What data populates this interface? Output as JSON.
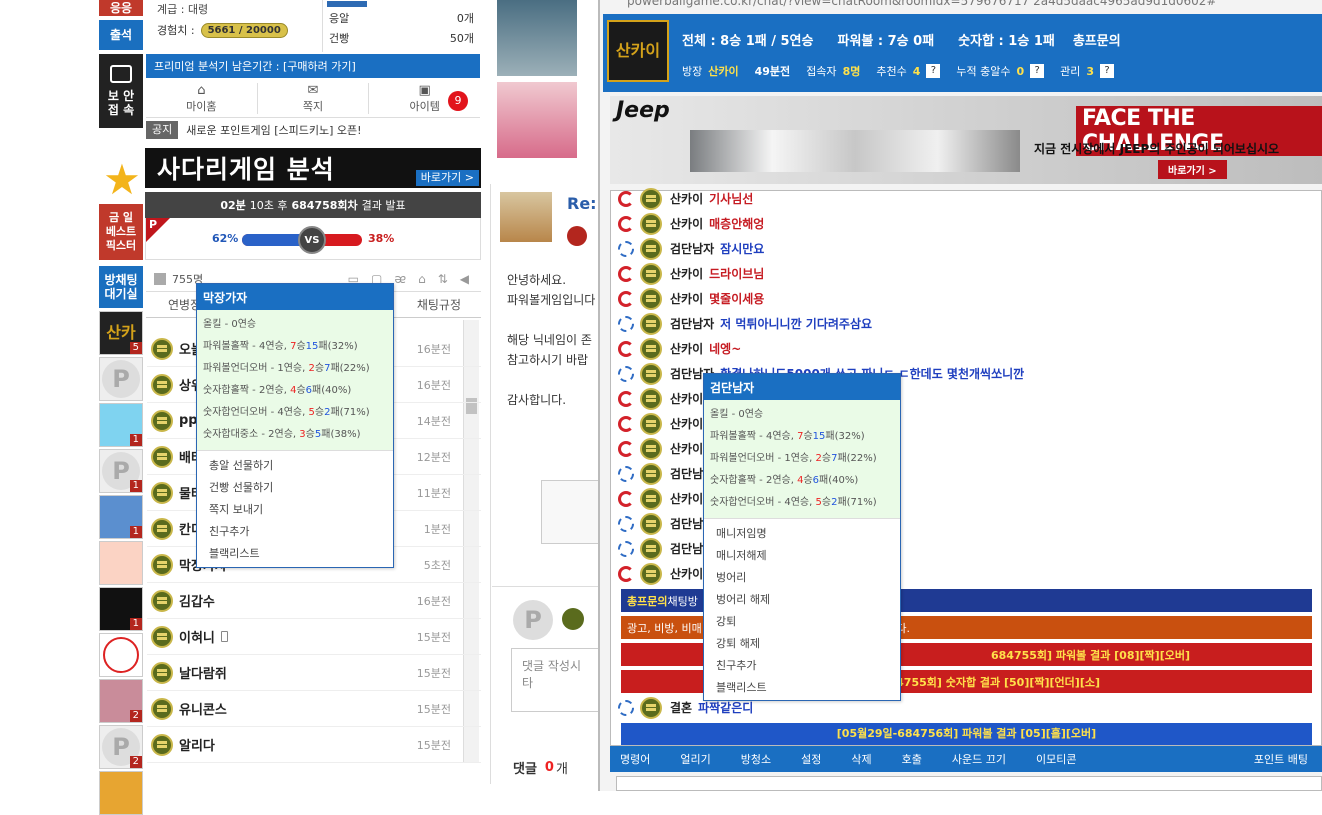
{
  "left_menu": {
    "top_btn": "응응",
    "attendance": "출석",
    "security": "보 안\n접 속",
    "best": "금 일\n베스트\n픽스터",
    "waiting_room": "방채팅\n대기실"
  },
  "profile": {
    "grade_label": "계급 : 대령",
    "exp_label": "경험치 :",
    "exp_value": "5661 / 20000",
    "premium": "프리미엄 분석기 남은기간 : [구매하려 가기]",
    "nav": [
      "마이홈",
      "쪽지",
      "아이템"
    ],
    "item_count": "9",
    "notice_tag": "공지",
    "notice": "새로운 포인트게임 [스피드키노] 오픈!",
    "stats": [
      {
        "label": "응알",
        "value": "0개"
      },
      {
        "label": "건빵",
        "value": "50개"
      }
    ]
  },
  "ladder": {
    "banner": "사다리게임 분석",
    "banner_btn": "바로가기 >",
    "countdown_pre": "02분",
    "countdown_mid": "10초 후",
    "round": "684758회차",
    "countdown_post": "결과 발표",
    "left_pct": "62%",
    "right_pct": "38%",
    "vs": "VS",
    "left_pct_value": 62
  },
  "userlist": {
    "count": "755명",
    "tabs": [
      "연병장",
      "채팅규정"
    ],
    "users": [
      {
        "name": "오늘",
        "time": "16분전"
      },
      {
        "name": "상위",
        "time": "16분전"
      },
      {
        "name": "pp",
        "time": "14분전"
      },
      {
        "name": "배타",
        "time": "12분전"
      },
      {
        "name": "물타",
        "time": "11분전"
      },
      {
        "name": "칸디",
        "time": "1분전"
      },
      {
        "name": "막장가자",
        "time": "5초전"
      },
      {
        "name": "김갑수",
        "time": "16분전"
      },
      {
        "name": "이혀니",
        "time": "15분전"
      },
      {
        "name": "날다람쥐",
        "time": "15분전"
      },
      {
        "name": "유니콘스",
        "time": "15분전"
      },
      {
        "name": "알리다",
        "time": "15분전"
      }
    ]
  },
  "popup1": {
    "title": "막장가자",
    "stats": [
      {
        "pre": "올킬 - 0연승",
        "w": "",
        "l": "",
        "pct": ""
      },
      {
        "pre": "파워볼홀짝 - 4연승, ",
        "w": "7",
        "l": "15",
        "pct": "(32%)"
      },
      {
        "pre": "파워볼언더오버 - 1연승, ",
        "w": "2",
        "l": "7",
        "pct": "(22%)"
      },
      {
        "pre": "숫자합홀짝 - 2연승, ",
        "w": "4",
        "l": "6",
        "pct": "(40%)"
      },
      {
        "pre": "숫자합언더오버 - 4연승, ",
        "w": "5",
        "l": "2",
        "pct": "(71%)"
      },
      {
        "pre": "숫자합대중소 - 2연승, ",
        "w": "3",
        "l": "5",
        "pct": "(38%)"
      }
    ],
    "menu": [
      "총알 선물하기",
      "건빵 선물하기",
      "쪽지 보내기",
      "친구추가",
      "블랙리스트"
    ]
  },
  "popup2": {
    "title": "검단남자",
    "stats": [
      {
        "pre": "올킬 - 0연승",
        "w": "",
        "l": "",
        "pct": ""
      },
      {
        "pre": "파워볼홀짝 - 4연승, ",
        "w": "7",
        "l": "15",
        "pct": "(32%)"
      },
      {
        "pre": "파워볼언더오버 - 1연승, ",
        "w": "2",
        "l": "7",
        "pct": "(22%)"
      },
      {
        "pre": "숫자합홀짝 - 2연승, ",
        "w": "4",
        "l": "6",
        "pct": "(40%)"
      },
      {
        "pre": "숫자합언더오버 - 4연승, ",
        "w": "5",
        "l": "2",
        "pct": "(71%)"
      }
    ],
    "menu": [
      "매니저임명",
      "매니저해제",
      "벙어리",
      "벙어리 해제",
      "강퇴",
      "강퇴 해제",
      "친구추가",
      "블랙리스트"
    ]
  },
  "post": {
    "re": "Re:",
    "lines": [
      "안녕하세요.",
      "파워볼게임입니다",
      "",
      "해당 닉네임이 존",
      "참고하시기 바랍",
      "",
      "감사합니다."
    ],
    "comment_placeholder": "댓글 작성시 타",
    "comment_label": "댓글",
    "comment_count": "0",
    "comment_unit": "개"
  },
  "chatwin": {
    "url": "powerballgame.co.kr/chat/?view=chatRoom&roomIdx=579676717 2a4d5daac4965ad9d1d0602#",
    "room_logo": "산카이",
    "record": "전체 : 8승 1패 / 5연승",
    "powerball": "파워볼 : 7승 0패",
    "numsum": "숫자합 : 1승 1패",
    "general": "총프문의",
    "info": [
      {
        "k": "방장",
        "v": "산카이"
      },
      {
        "k": "",
        "v": "49분전"
      },
      {
        "k": "접속자",
        "v": "8명"
      },
      {
        "k": "추천수",
        "v": "4"
      },
      {
        "k": "누적 충알수",
        "v": "0"
      },
      {
        "k": "관리",
        "v": "3"
      }
    ],
    "ad": {
      "brand": "Jeep",
      "headline": "FACE THE CHALLENGE",
      "sub": "지금 전시장에서 JEEP의 주인공이 되어보십시오",
      "btn": "바로가기 >"
    },
    "messages": [
      {
        "t": "r",
        "n": "산카이",
        "m": "기사님선"
      },
      {
        "t": "r",
        "n": "산카이",
        "m": "매층안해엉"
      },
      {
        "t": "b",
        "n": "검단남자",
        "m": "잠시만요"
      },
      {
        "t": "r",
        "n": "산카이",
        "m": "드라이브님"
      },
      {
        "t": "r",
        "n": "산카이",
        "m": "몇줄이세용"
      },
      {
        "t": "b",
        "n": "검단남자",
        "m": "저 먹튀아니니깐 기다려주삼요"
      },
      {
        "t": "r",
        "n": "산카이",
        "m": "네엥~"
      },
      {
        "t": "b",
        "n": "검단남자",
        "m": "확결나하니드5000개 쏘고 짜니ㄷ ㄷ한데도 몇천개씩쏘니깐"
      },
      {
        "t": "r",
        "n": "산카이",
        "m": ""
      },
      {
        "t": "r",
        "n": "산카이",
        "m": ""
      },
      {
        "t": "r",
        "n": "산카이",
        "m": ""
      },
      {
        "t": "b",
        "n": "검단남자",
        "m": "요"
      },
      {
        "t": "r",
        "n": "산카이",
        "m": ""
      },
      {
        "t": "b",
        "n": "검단남자",
        "m": ""
      },
      {
        "t": "b",
        "n": "검단남자",
        "m": ""
      },
      {
        "t": "r",
        "n": "산카이",
        "m": ""
      }
    ],
    "bars": [
      {
        "c": "#1f3a93",
        "a": "총프문의",
        "b": " 채팅방"
      },
      {
        "c": "#c9500f",
        "a": "",
        "b": "광고, 비방, 비매",
        "tail": "니다."
      },
      {
        "c": "#c81e1e",
        "a": "",
        "b": "",
        "tail": "684755회] 파워볼 결과 [08][짝][오버]"
      },
      {
        "c": "#c81e1e",
        "a": "",
        "b": "",
        "tail": "4755회] 숫자합 결과 [50][짝][언더][소]"
      }
    ],
    "last_msg": {
      "n": "결혼",
      "m": "파짝같은디"
    },
    "result_bar": "[05월29일-684756회] 파워볼 결과 [05][홀][오버]",
    "toolbar": [
      "명령어",
      "얼리기",
      "방청소",
      "설정",
      "삭제",
      "호출",
      "사운드 끄기",
      "이모티콘",
      "포인트 배팅"
    ]
  }
}
